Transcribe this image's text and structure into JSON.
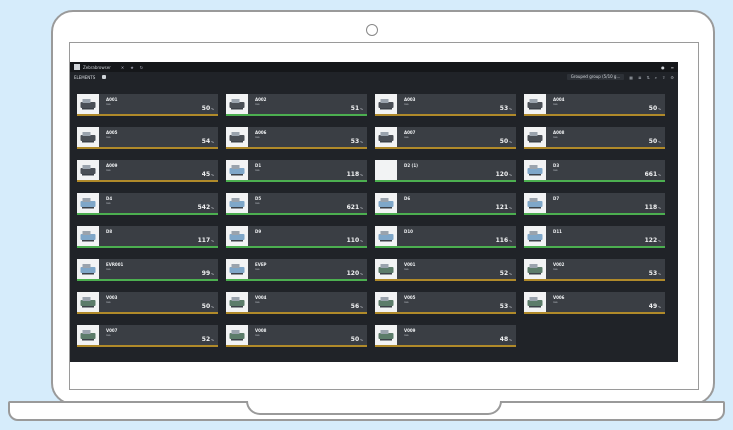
{
  "window": {
    "title": "Zebrabrowser",
    "right_icons": [
      "bell-icon",
      "menu-icon"
    ]
  },
  "toolbar": {
    "view_label": "ELEMENTS",
    "view_select": "Grouped group (5/10 g...",
    "buttons": [
      "grid-view",
      "list-view",
      "sort",
      "filter",
      "export",
      "settings"
    ]
  },
  "tiles": [
    {
      "name": "A001",
      "sub": "res",
      "value": "50",
      "unit": "%",
      "status": "warn",
      "thumb": "machine-dark"
    },
    {
      "name": "A002",
      "sub": "res",
      "value": "51",
      "unit": "%",
      "status": "ok",
      "thumb": "machine-dark"
    },
    {
      "name": "A003",
      "sub": "res",
      "value": "53",
      "unit": "%",
      "status": "warn",
      "thumb": "machine-dark"
    },
    {
      "name": "A004",
      "sub": "res",
      "value": "50",
      "unit": "%",
      "status": "warn",
      "thumb": "machine-dark"
    },
    {
      "name": "A005",
      "sub": "res",
      "value": "54",
      "unit": "%",
      "status": "warn",
      "thumb": "machine-dark"
    },
    {
      "name": "A006",
      "sub": "res",
      "value": "53",
      "unit": "%",
      "status": "warn",
      "thumb": "machine-dark"
    },
    {
      "name": "A007",
      "sub": "res",
      "value": "50",
      "unit": "%",
      "status": "warn",
      "thumb": "machine-dark"
    },
    {
      "name": "A008",
      "sub": "res",
      "value": "50",
      "unit": "%",
      "status": "warn",
      "thumb": "machine-dark"
    },
    {
      "name": "A009",
      "sub": "res",
      "value": "45",
      "unit": "%",
      "status": "warn",
      "thumb": "machine-dark"
    },
    {
      "name": "D1",
      "sub": "res",
      "value": "118",
      "unit": "%",
      "status": "ok",
      "thumb": "machine-blue"
    },
    {
      "name": "D2 (1)",
      "sub": "",
      "value": "120",
      "unit": "%",
      "status": "ok",
      "thumb": "blank"
    },
    {
      "name": "D3",
      "sub": "res",
      "value": "661",
      "unit": "%",
      "status": "ok",
      "thumb": "machine-blue"
    },
    {
      "name": "D4",
      "sub": "res",
      "value": "542",
      "unit": "%",
      "status": "ok",
      "thumb": "machine-blue"
    },
    {
      "name": "D5",
      "sub": "res",
      "value": "621",
      "unit": "%",
      "status": "ok",
      "thumb": "machine-blue"
    },
    {
      "name": "D6",
      "sub": "",
      "value": "121",
      "unit": "%",
      "status": "ok",
      "thumb": "machine-blue"
    },
    {
      "name": "D7",
      "sub": "",
      "value": "118",
      "unit": "%",
      "status": "ok",
      "thumb": "machine-blue"
    },
    {
      "name": "D8",
      "sub": "",
      "value": "117",
      "unit": "%",
      "status": "ok",
      "thumb": "machine-blue"
    },
    {
      "name": "D9",
      "sub": "",
      "value": "110",
      "unit": "%",
      "status": "ok",
      "thumb": "machine-blue"
    },
    {
      "name": "D10",
      "sub": "",
      "value": "116",
      "unit": "%",
      "status": "ok",
      "thumb": "machine-blue"
    },
    {
      "name": "D11",
      "sub": "",
      "value": "122",
      "unit": "%",
      "status": "ok",
      "thumb": "machine-blue"
    },
    {
      "name": "EVR001",
      "sub": "res",
      "value": "99",
      "unit": "%",
      "status": "ok",
      "thumb": "machine-blue"
    },
    {
      "name": "EVEP",
      "sub": "res",
      "value": "120",
      "unit": "%",
      "status": "ok",
      "thumb": "machine-blue"
    },
    {
      "name": "V001",
      "sub": "res",
      "value": "52",
      "unit": "%",
      "status": "warn",
      "thumb": "machine-green"
    },
    {
      "name": "V002",
      "sub": "res",
      "value": "53",
      "unit": "%",
      "status": "warn",
      "thumb": "machine-green"
    },
    {
      "name": "V003",
      "sub": "res",
      "value": "50",
      "unit": "%",
      "status": "warn",
      "thumb": "machine-green"
    },
    {
      "name": "V004",
      "sub": "res",
      "value": "56",
      "unit": "%",
      "status": "warn",
      "thumb": "machine-green"
    },
    {
      "name": "V005",
      "sub": "res",
      "value": "53",
      "unit": "%",
      "status": "warn",
      "thumb": "machine-green"
    },
    {
      "name": "V006",
      "sub": "res",
      "value": "49",
      "unit": "%",
      "status": "warn",
      "thumb": "machine-green"
    },
    {
      "name": "V007",
      "sub": "res",
      "value": "52",
      "unit": "%",
      "status": "warn",
      "thumb": "machine-green"
    },
    {
      "name": "V008",
      "sub": "res",
      "value": "50",
      "unit": "%",
      "status": "warn",
      "thumb": "machine-green"
    },
    {
      "name": "V009",
      "sub": "res",
      "value": "48",
      "unit": "%",
      "status": "warn",
      "thumb": "machine-green"
    }
  ],
  "colors": {
    "app_bg": "#202328",
    "card_bg": "#3a3e44",
    "ok": "#4caf50",
    "warn": "#b08a2a"
  }
}
